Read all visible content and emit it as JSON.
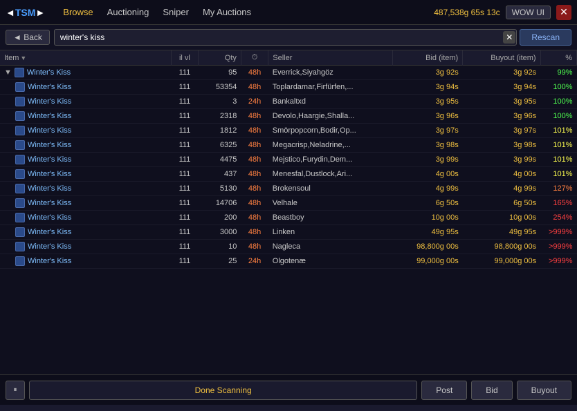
{
  "navbar": {
    "logo_tsm": "TSM",
    "logo_bracket_open": "◄",
    "logo_bracket_close": "►",
    "nav_browse": "Browse",
    "nav_auctioning": "Auctioning",
    "nav_sniper": "Sniper",
    "nav_myauctions": "My Auctions",
    "gold": "487,538g 65s 13c",
    "wow_ui": "WOW UI",
    "close": "✕"
  },
  "search": {
    "back_label": "◄ Back",
    "value": "winter's kiss",
    "clear": "✕",
    "rescan": "Rescan"
  },
  "table": {
    "headers": [
      "Item",
      "il vl",
      "Qty",
      "⏱",
      "Seller",
      "Bid (item)",
      "Buyout (item)",
      "%"
    ],
    "rows": [
      {
        "item": "Winter's Kiss",
        "group": true,
        "ilvl": "111",
        "qty": "95",
        "time": "48h",
        "seller": "Everrick,Siyahgöz",
        "bid": "3g 92s",
        "buyout": "3g 92s",
        "pct": "99%",
        "pct_class": "pct-99"
      },
      {
        "item": "Winter's Kiss",
        "group": false,
        "ilvl": "111",
        "qty": "53354",
        "time": "48h",
        "seller": "Toplardamar,Firfürfen,...",
        "bid": "3g 94s",
        "buyout": "3g 94s",
        "pct": "100%",
        "pct_class": "pct-100"
      },
      {
        "item": "Winter's Kiss",
        "group": false,
        "ilvl": "111",
        "qty": "3",
        "time": "24h",
        "seller": "Bankaltxd",
        "bid": "3g 95s",
        "buyout": "3g 95s",
        "pct": "100%",
        "pct_class": "pct-100"
      },
      {
        "item": "Winter's Kiss",
        "group": false,
        "ilvl": "111",
        "qty": "2318",
        "time": "48h",
        "seller": "Devolo,Haargie,Shalla...",
        "bid": "3g 96s",
        "buyout": "3g 96s",
        "pct": "100%",
        "pct_class": "pct-100"
      },
      {
        "item": "Winter's Kiss",
        "group": false,
        "ilvl": "111",
        "qty": "1812",
        "time": "48h",
        "seller": "Smörpopcorn,Bodir,Op...",
        "bid": "3g 97s",
        "buyout": "3g 97s",
        "pct": "101%",
        "pct_class": "pct-101"
      },
      {
        "item": "Winter's Kiss",
        "group": false,
        "ilvl": "111",
        "qty": "6325",
        "time": "48h",
        "seller": "Megacrisp,Neladrine,...",
        "bid": "3g 98s",
        "buyout": "3g 98s",
        "pct": "101%",
        "pct_class": "pct-101"
      },
      {
        "item": "Winter's Kiss",
        "group": false,
        "ilvl": "111",
        "qty": "4475",
        "time": "48h",
        "seller": "Mejstico,Furydin,Dem...",
        "bid": "3g 99s",
        "buyout": "3g 99s",
        "pct": "101%",
        "pct_class": "pct-101"
      },
      {
        "item": "Winter's Kiss",
        "group": false,
        "ilvl": "111",
        "qty": "437",
        "time": "48h",
        "seller": "Menesfal,Dustlock,Ari...",
        "bid": "4g 00s",
        "buyout": "4g 00s",
        "pct": "101%",
        "pct_class": "pct-101"
      },
      {
        "item": "Winter's Kiss",
        "group": false,
        "ilvl": "111",
        "qty": "5130",
        "time": "48h",
        "seller": "Brokensoul",
        "bid": "4g 99s",
        "buyout": "4g 99s",
        "pct": "127%",
        "pct_class": "pct-127"
      },
      {
        "item": "Winter's Kiss",
        "group": false,
        "ilvl": "111",
        "qty": "14706",
        "time": "48h",
        "seller": "Velhale",
        "bid": "6g 50s",
        "buyout": "6g 50s",
        "pct": "165%",
        "pct_class": "pct-165"
      },
      {
        "item": "Winter's Kiss",
        "group": false,
        "ilvl": "111",
        "qty": "200",
        "time": "48h",
        "seller": "Beastboy",
        "bid": "10g 00s",
        "buyout": "10g 00s",
        "pct": "254%",
        "pct_class": "pct-254"
      },
      {
        "item": "Winter's Kiss",
        "group": false,
        "ilvl": "111",
        "qty": "3000",
        "time": "48h",
        "seller": "Linken",
        "bid": "49g 95s",
        "buyout": "49g 95s",
        "pct": ">999%",
        "pct_class": "pct-999"
      },
      {
        "item": "Winter's Kiss",
        "group": false,
        "ilvl": "111",
        "qty": "10",
        "time": "48h",
        "seller": "Nagleca",
        "bid": "98,800g 00s",
        "buyout": "98,800g 00s",
        "pct": ">999%",
        "pct_class": "pct-999"
      },
      {
        "item": "Winter's Kiss",
        "group": false,
        "ilvl": "111",
        "qty": "25",
        "time": "24h",
        "seller": "Olgotenæ",
        "bid": "99,000g 00s",
        "buyout": "99,000g 00s",
        "pct": ">999%",
        "pct_class": "pct-999"
      }
    ]
  },
  "bottom": {
    "pause_icon": "⏸",
    "status": "Done Scanning",
    "post_label": "Post",
    "bid_label": "Bid",
    "buyout_label": "Buyout"
  }
}
